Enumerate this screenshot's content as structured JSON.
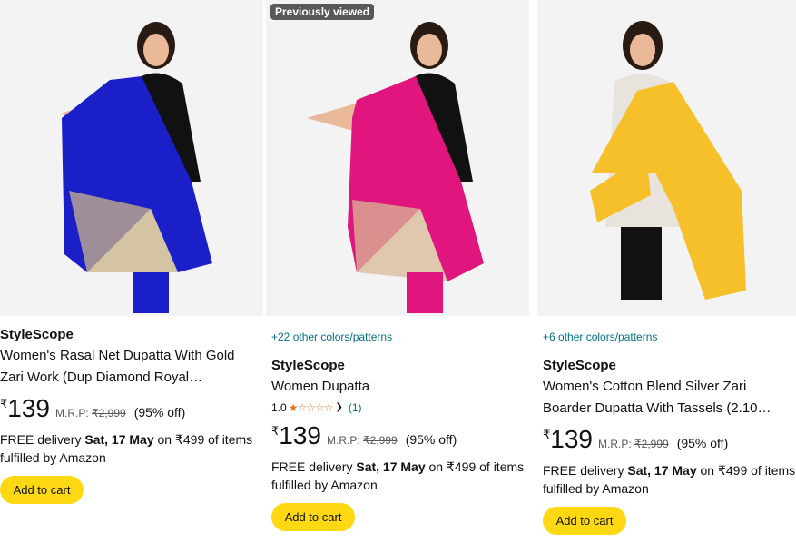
{
  "products": [
    {
      "brand": "StyleScope",
      "title_line1": "Women's Rasal Net Dupatta With Gold",
      "title_line2": "Zari Work (Dup Diamond Royal…",
      "currency": "₹",
      "price": "139",
      "mrp_label": "M.R.P:",
      "mrp": "₹2,999",
      "discount": "(95% off)",
      "delivery_prefix": "FREE delivery",
      "delivery_date": "Sat, 17 May",
      "delivery_suffix": "on ₹499 of items",
      "fulfilled": "fulfilled by Amazon",
      "cart_label": "Add to cart",
      "dupatta_color": "#1a1fc8"
    },
    {
      "badge": "Previously viewed",
      "colors_link": "+22 other colors/patterns",
      "brand": "StyleScope",
      "title_line1": "Women Dupatta",
      "rating_value": "1.0",
      "stars": "★☆☆☆☆",
      "rating_count": "(1)",
      "currency": "₹",
      "price": "139",
      "mrp_label": "M.R.P:",
      "mrp": "₹2,999",
      "discount": "(95% off)",
      "delivery_prefix": "FREE delivery",
      "delivery_date": "Sat, 17 May",
      "delivery_suffix": "on ₹499 of items",
      "fulfilled": "fulfilled by Amazon",
      "cart_label": "Add to cart",
      "dupatta_color": "#e0157e"
    },
    {
      "colors_link": "+6 other colors/patterns",
      "brand": "StyleScope",
      "title_line1": "Women's Cotton Blend Silver Zari",
      "title_line2": "Boarder Dupatta With Tassels (2.10…",
      "currency": "₹",
      "price": "139",
      "mrp_label": "M.R.P:",
      "mrp": "₹2,999",
      "discount": "(95% off)",
      "delivery_prefix": "FREE delivery",
      "delivery_date": "Sat, 17 May",
      "delivery_suffix": "on ₹499 of items",
      "fulfilled": "fulfilled by Amazon",
      "cart_label": "Add to cart",
      "dupatta_color": "#f5c02a"
    }
  ]
}
